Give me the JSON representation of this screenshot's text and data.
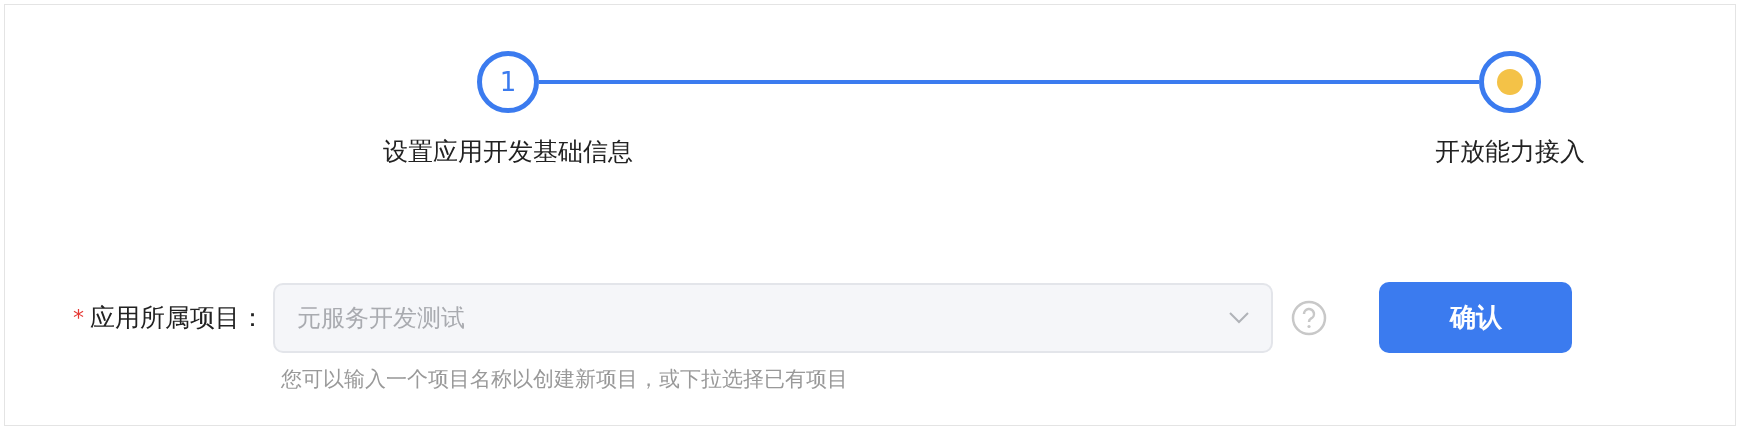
{
  "steps": [
    {
      "kind": "numbered",
      "number": "1",
      "label": "设置应用开发基础信息"
    },
    {
      "kind": "current",
      "label": "开放能力接入"
    }
  ],
  "form": {
    "label": "应用所属项目：",
    "required_mark": "*",
    "field": {
      "value": "元服务开发测试",
      "disabled": true
    },
    "hint": "您可以输入一个项目名称以创建新项目，或下拉选择已有项目",
    "button": "确认"
  }
}
